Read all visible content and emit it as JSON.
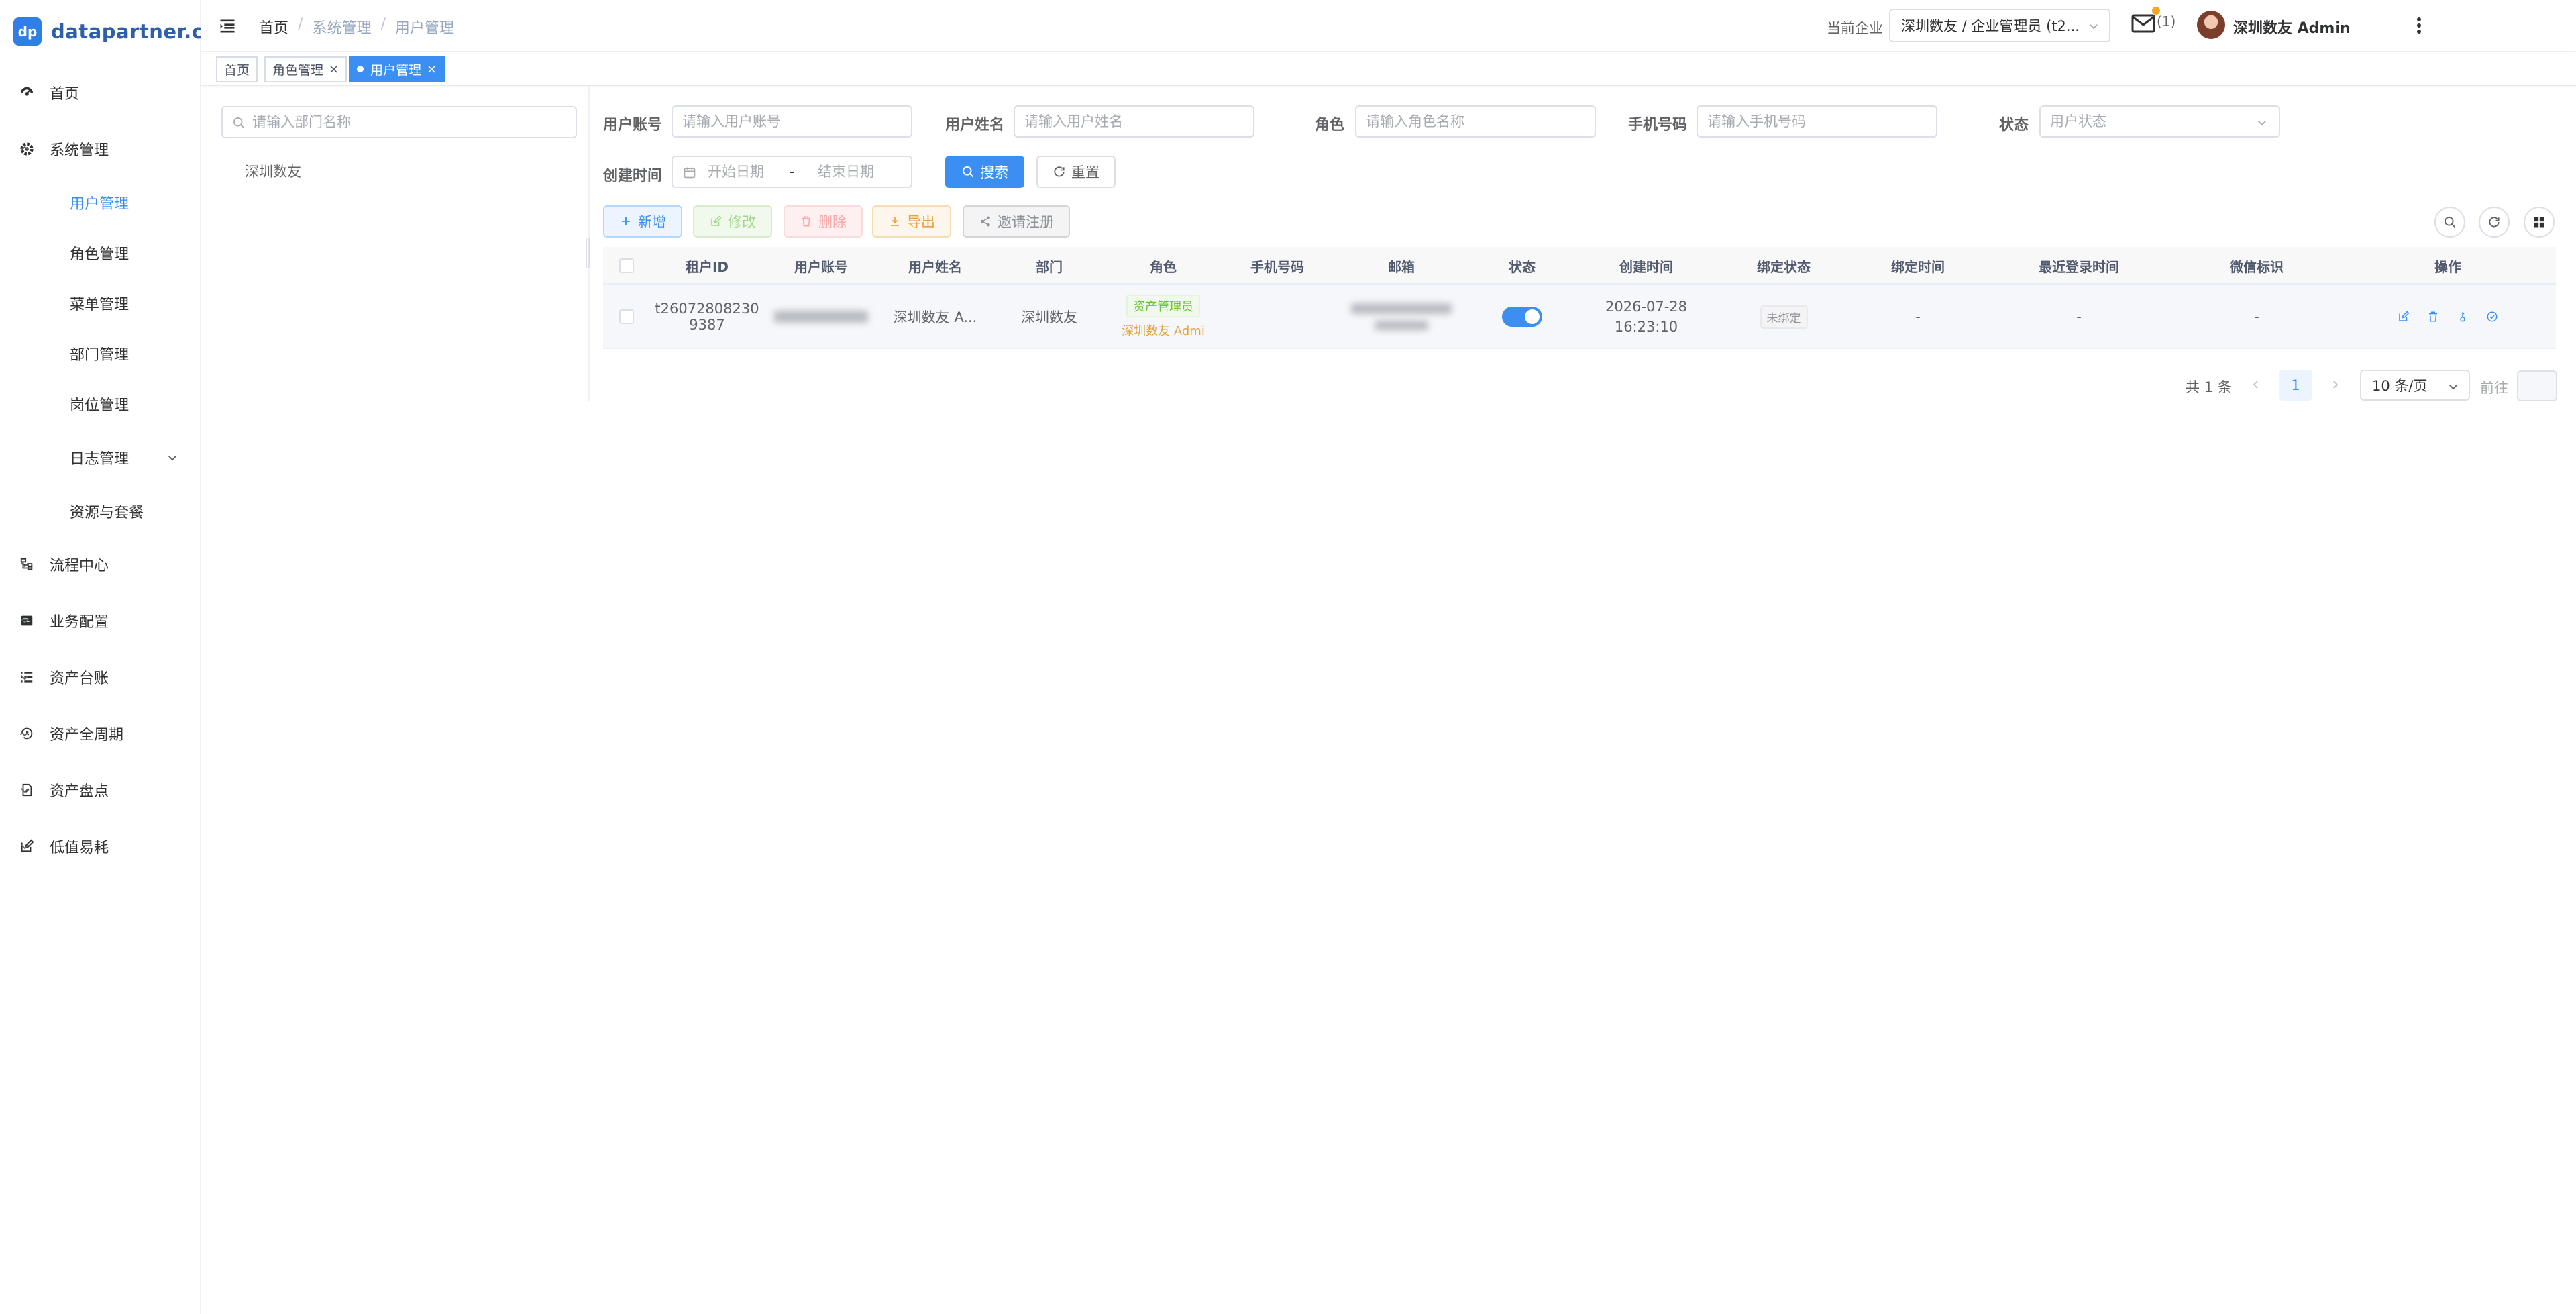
{
  "app": {
    "logo_text": "dp",
    "name": "datapartner.cn"
  },
  "sidebar": {
    "items": [
      {
        "label": "首页",
        "icon": "dashboard-icon"
      },
      {
        "label": "系统管理",
        "icon": "gear-icon",
        "expanded": true
      },
      {
        "label": "流程中心",
        "icon": "flow-icon"
      },
      {
        "label": "业务配置",
        "icon": "config-icon"
      },
      {
        "label": "资产台账",
        "icon": "list-icon"
      },
      {
        "label": "资产全周期",
        "icon": "cycle-icon"
      },
      {
        "label": "资产盘点",
        "icon": "inventory-icon"
      },
      {
        "label": "低值易耗",
        "icon": "edit-icon"
      }
    ],
    "submenu": [
      {
        "label": "用户管理",
        "active": true
      },
      {
        "label": "角色管理"
      },
      {
        "label": "菜单管理"
      },
      {
        "label": "部门管理"
      },
      {
        "label": "岗位管理"
      },
      {
        "label": "日志管理"
      },
      {
        "label": "资源与套餐"
      }
    ]
  },
  "header": {
    "breadcrumb": [
      "首页",
      "系统管理",
      "用户管理"
    ],
    "tenant_label": "当前企业",
    "tenant_value": "深圳数友 / 企业管理员 (t2...",
    "mail_count": "(1)",
    "user_name": "深圳数友 Admin"
  },
  "tags": [
    {
      "label": "首页"
    },
    {
      "label": "角色管理",
      "closable": true
    },
    {
      "label": "用户管理",
      "closable": true,
      "active": true
    }
  ],
  "dept": {
    "search_placeholder": "请输入部门名称",
    "tree_root": "深圳数友"
  },
  "filters": {
    "account": {
      "label": "用户账号",
      "placeholder": "请输入用户账号"
    },
    "name": {
      "label": "用户姓名",
      "placeholder": "请输入用户姓名"
    },
    "role": {
      "label": "角色",
      "placeholder": "请输入角色名称"
    },
    "phone": {
      "label": "手机号码",
      "placeholder": "请输入手机号码"
    },
    "status": {
      "label": "状态",
      "placeholder": "用户状态"
    },
    "created": {
      "label": "创建时间",
      "start_placeholder": "开始日期",
      "end_placeholder": "结束日期",
      "separator": "-"
    },
    "search_button": "搜索",
    "reset_button": "重置"
  },
  "toolbar": {
    "add": "新增",
    "edit": "修改",
    "delete": "删除",
    "export": "导出",
    "invite": "邀请注册"
  },
  "table": {
    "columns": [
      "租户ID",
      "用户账号",
      "用户姓名",
      "部门",
      "角色",
      "手机号码",
      "邮箱",
      "状态",
      "创建时间",
      "绑定状态",
      "绑定时间",
      "最近登录时间",
      "微信标识",
      "操作"
    ],
    "rows": [
      {
        "tenant_id_line1": "t26072808230",
        "tenant_id_line2": "9387",
        "account": "",
        "name": "深圳数友 A...",
        "dept": "深圳数友",
        "role_tag": "资产管理员",
        "role_tag2": "深圳数友 Admi",
        "phone": "",
        "email": "",
        "status_on": true,
        "created_date": "2026-07-28",
        "created_time": "16:23:10",
        "bind_status": "未绑定",
        "bind_time": "-",
        "last_login": "-",
        "wechat": "-"
      }
    ]
  },
  "pagination": {
    "total": "共 1 条",
    "page": "1",
    "page_size": "10 条/页",
    "goto_label": "前往"
  },
  "colors": {
    "primary": "#3b8ff3",
    "success": "#67c23a",
    "warning": "#e6a23c",
    "danger": "#f56c6c"
  }
}
